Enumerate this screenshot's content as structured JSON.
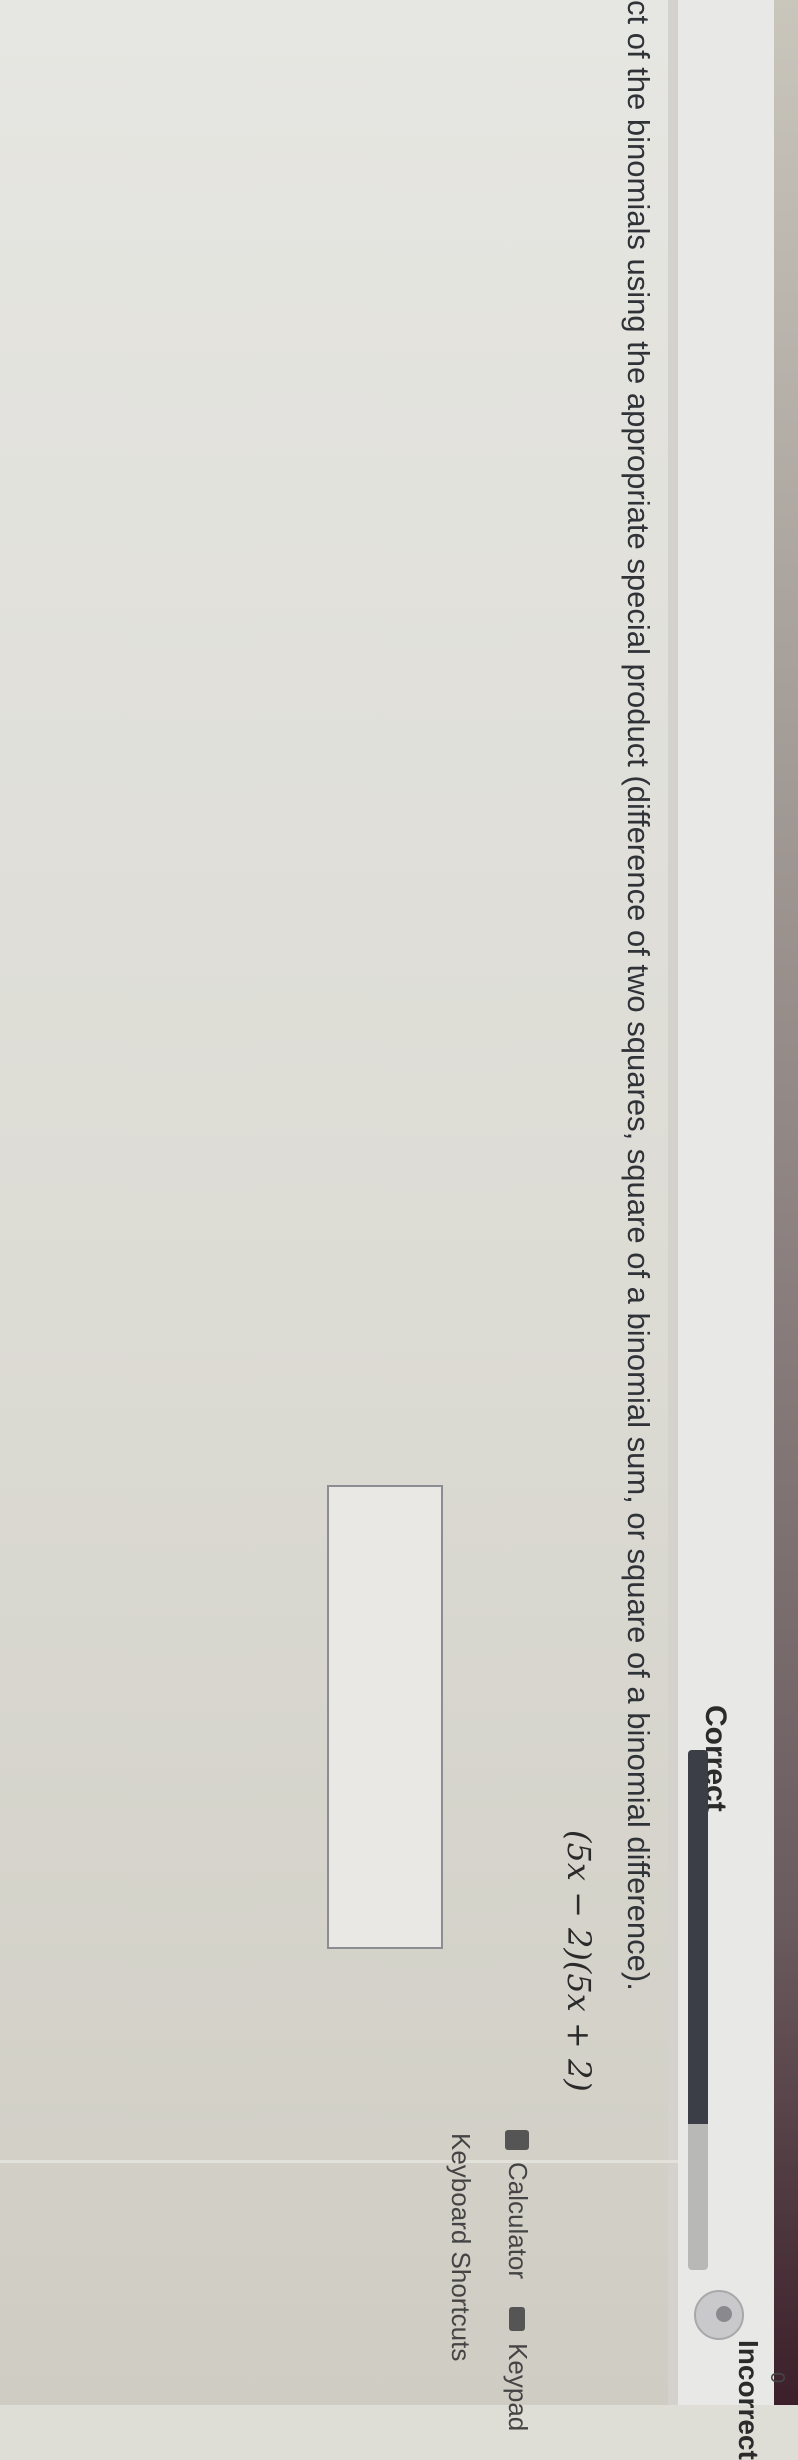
{
  "header": {
    "correct_label": "Correct",
    "incorrect_label": "Incorrect",
    "incorrect_count": "0",
    "progress_fraction": 0.72
  },
  "question": {
    "text": "ct of the binomials using the appropriate special product (difference of two squares, square of a binomial sum, or square of a binomial difference).",
    "expression": "(5x − 2)(5x + 2)"
  },
  "answer": {
    "value": ""
  },
  "tools": {
    "calculator_label": "Calculator",
    "keypad_label": "Keypad",
    "shortcuts_label": "Keyboard Shortcuts"
  },
  "colors": {
    "progress_fill": "#3b3d47",
    "progress_track": "#b8b8b6",
    "top_strip": "#3c1f2a"
  }
}
